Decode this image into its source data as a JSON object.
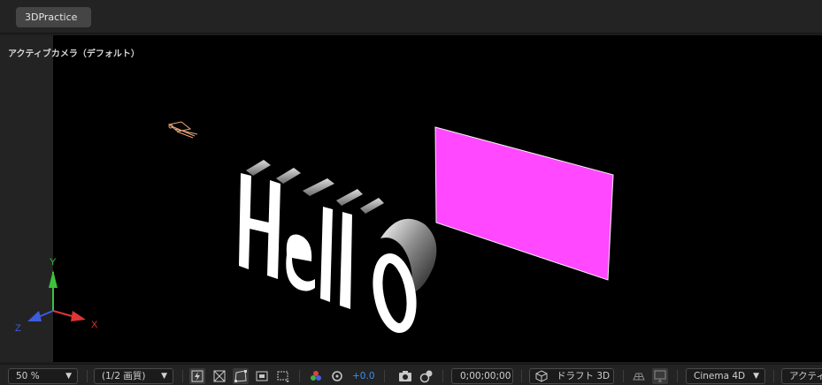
{
  "tab": {
    "label": "3DPractice"
  },
  "viewer": {
    "camera_label": "アクティブカメラ（デフォルト）"
  },
  "scene": {
    "text_layer": "Hello",
    "solid_color": "#ff48ff",
    "axes": {
      "x": "X",
      "y": "Y",
      "z": "Z"
    },
    "axis_colors": {
      "x": "#e03535",
      "y": "#3cc23c",
      "z": "#3d5ce0"
    }
  },
  "toolbar": {
    "magnification": "50 %",
    "resolution": "(1/2 画質)",
    "exposure": "+0.0",
    "timecode": "0;00;00;00",
    "draft_3d": "ドラフト 3D",
    "renderer": "Cinema 4D",
    "view": "アクティブ"
  }
}
